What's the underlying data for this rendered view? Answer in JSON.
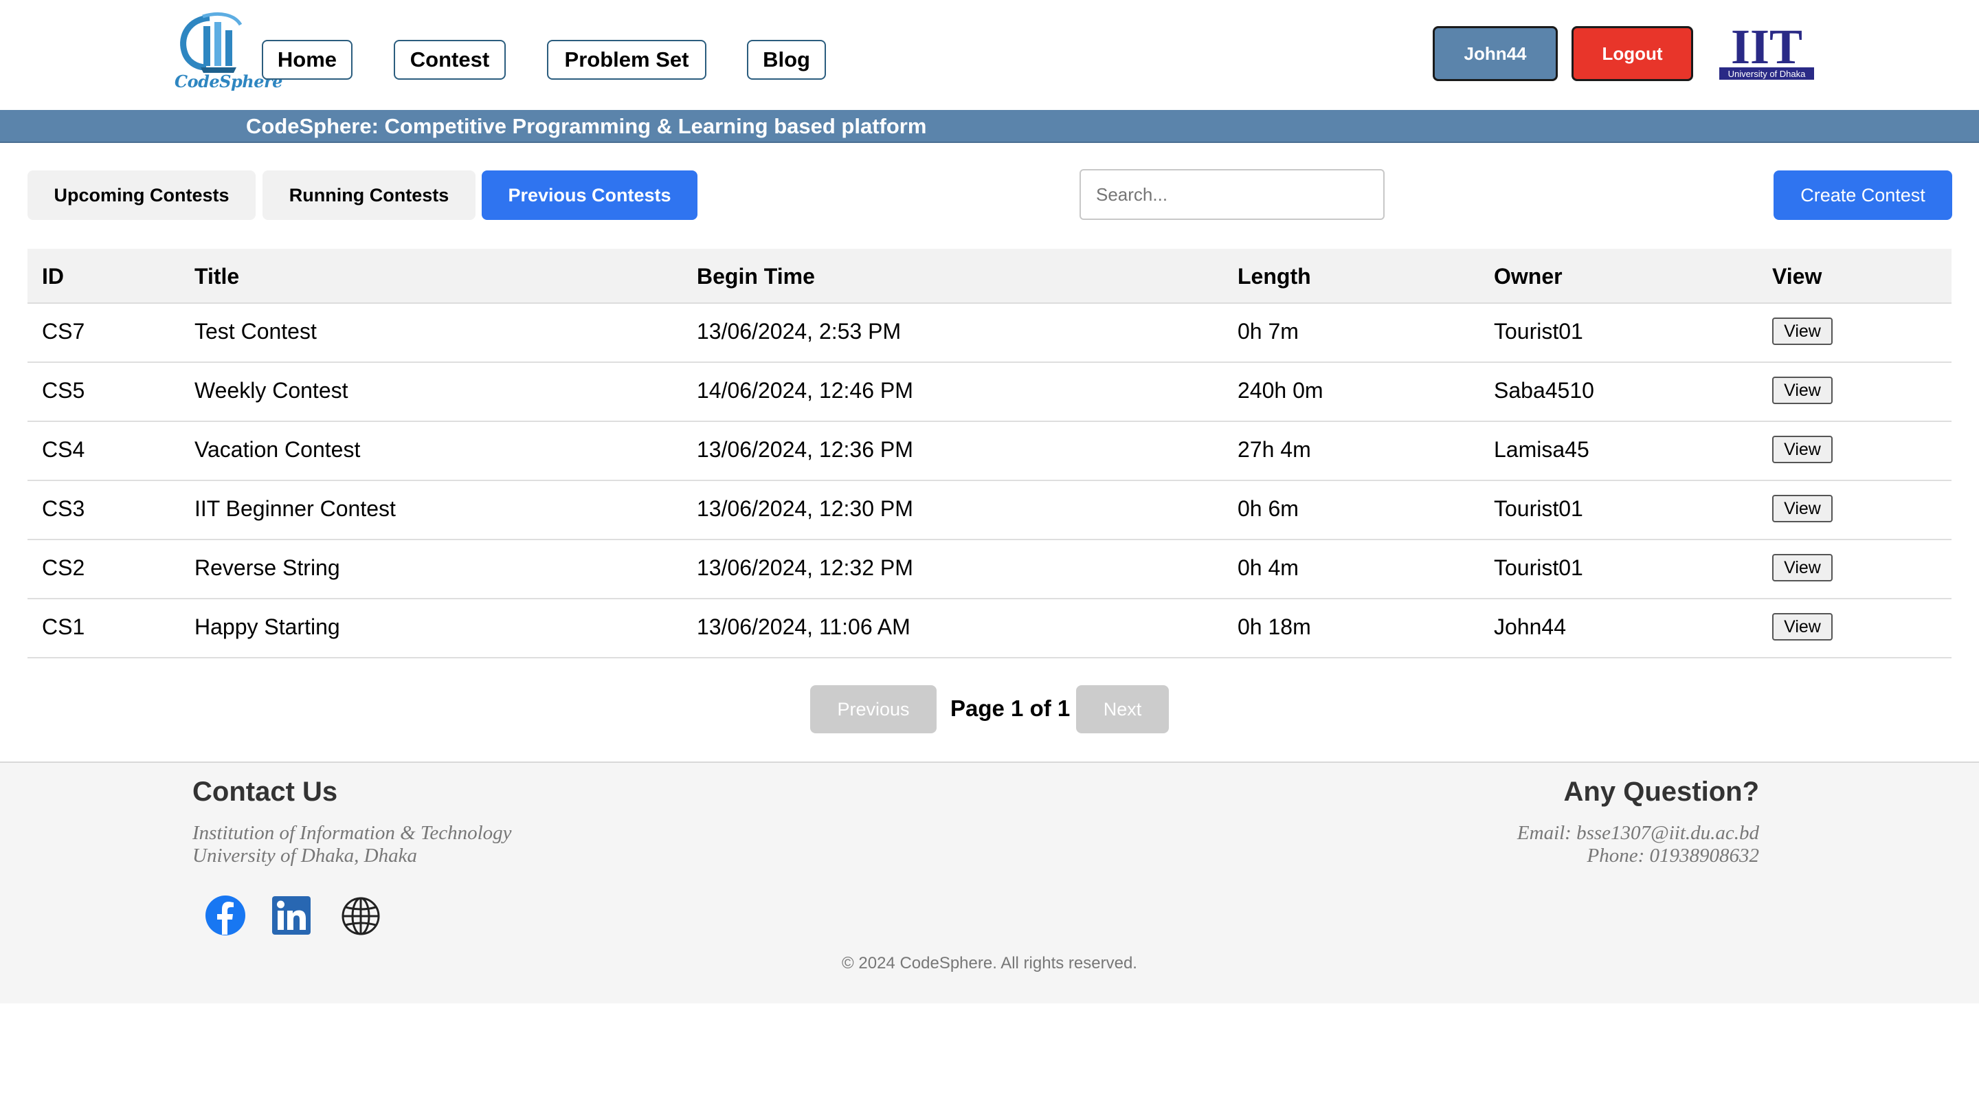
{
  "header": {
    "logo_text": "CodeSphere",
    "nav": [
      "Home",
      "Contest",
      "Problem Set",
      "Blog"
    ],
    "user_label": "John44",
    "logout_label": "Logout",
    "institute_logo_text": "IIT",
    "institute_logo_subtext": "University of Dhaka"
  },
  "banner": {
    "text": "CodeSphere: Competitive Programming & Learning based platform"
  },
  "tabs": [
    {
      "label": "Upcoming Contests",
      "active": false
    },
    {
      "label": "Running Contests",
      "active": false
    },
    {
      "label": "Previous Contests",
      "active": true
    }
  ],
  "search": {
    "placeholder": "Search...",
    "value": ""
  },
  "create_button": "Create Contest",
  "table": {
    "columns": [
      "ID",
      "Title",
      "Begin Time",
      "Length",
      "Owner",
      "View"
    ],
    "rows": [
      {
        "id": "CS7",
        "title": "Test Contest",
        "begin": "13/06/2024, 2:53 PM",
        "length": "0h 7m",
        "owner": "Tourist01",
        "view": "View"
      },
      {
        "id": "CS5",
        "title": "Weekly Contest",
        "begin": "14/06/2024, 12:46 PM",
        "length": "240h 0m",
        "owner": "Saba4510",
        "view": "View"
      },
      {
        "id": "CS4",
        "title": "Vacation Contest",
        "begin": "13/06/2024, 12:36 PM",
        "length": "27h 4m",
        "owner": "Lamisa45",
        "view": "View"
      },
      {
        "id": "CS3",
        "title": "IIT Beginner Contest",
        "begin": "13/06/2024, 12:30 PM",
        "length": "0h 6m",
        "owner": "Tourist01",
        "view": "View"
      },
      {
        "id": "CS2",
        "title": "Reverse String",
        "begin": "13/06/2024, 12:32 PM",
        "length": "0h 4m",
        "owner": "Tourist01",
        "view": "View"
      },
      {
        "id": "CS1",
        "title": "Happy Starting",
        "begin": "13/06/2024, 11:06 AM",
        "length": "0h 18m",
        "owner": "John44",
        "view": "View"
      }
    ]
  },
  "pagination": {
    "previous": "Previous",
    "label": "Page 1 of 1",
    "next": "Next"
  },
  "footer": {
    "contact_heading": "Contact Us",
    "contact_line1": "Institution of Information & Technology",
    "contact_line2": "University of Dhaka, Dhaka",
    "question_heading": "Any Question?",
    "email": "Email: bsse1307@iit.du.ac.bd",
    "phone": "Phone: 01938908632",
    "social_icons": [
      "facebook-icon",
      "linkedin-icon",
      "globe-icon"
    ],
    "copyright": "© 2024 CodeSphere. All rights reserved."
  },
  "colors": {
    "banner": "#5b84ab",
    "user_button": "#5b84ab",
    "logout_button": "#e8352a",
    "active_tab": "#2f74f0",
    "create_button": "#2f74f0",
    "disabled_button": "#cccccc"
  }
}
